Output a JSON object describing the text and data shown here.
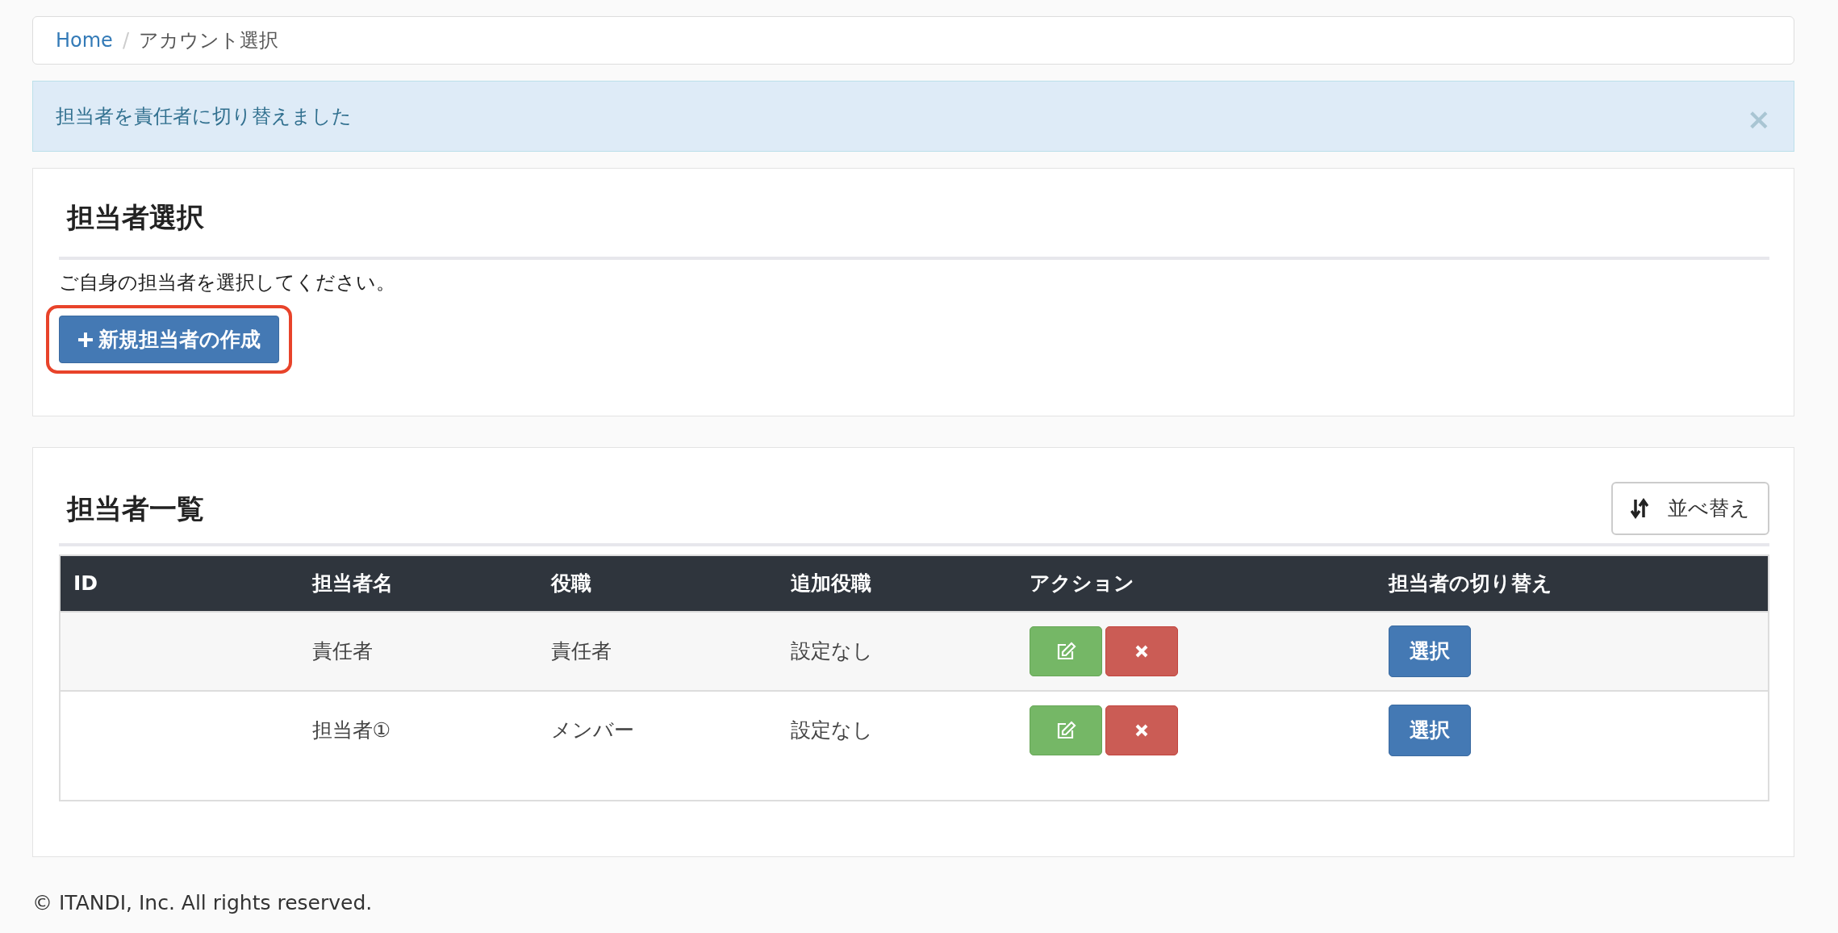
{
  "breadcrumb": [
    {
      "label": "Home",
      "link": true
    },
    {
      "label": "アカウント選択",
      "link": false
    }
  ],
  "breadcrumb_separator": "/",
  "alert": {
    "message": "担当者を責任者に切り替えました",
    "close": "×"
  },
  "select_panel": {
    "title": "担当者選択",
    "description": "ご自身の担当者を選択してください。",
    "create_button": {
      "label": "新規担当者の作成",
      "highlighted": true
    }
  },
  "list_panel": {
    "title": "担当者一覧",
    "sort_button": "並べ替え",
    "table": {
      "columns": [
        "ID",
        "担当者名",
        "役職",
        "追加役職",
        "アクション",
        "担当者の切り替え"
      ],
      "rows": [
        {
          "name": "責任者",
          "role": "責任者",
          "extra_role": "設定なし",
          "switch": "選択"
        },
        {
          "name": "担当者①",
          "role": "メンバー",
          "extra_role": "設定なし",
          "switch": "選択"
        }
      ]
    }
  },
  "footer": "© ITANDI, Inc. All rights reserved."
}
